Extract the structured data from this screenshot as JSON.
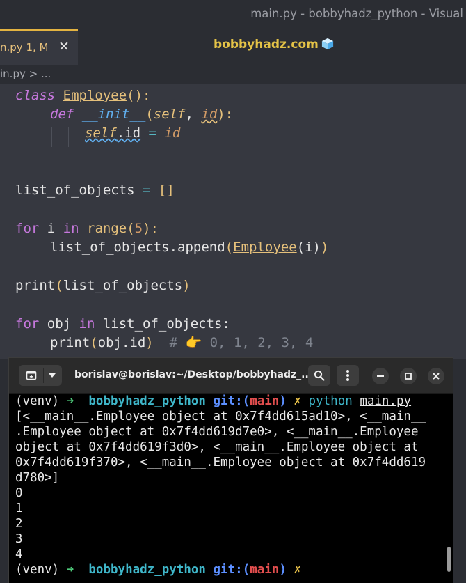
{
  "window": {
    "title": "main.py - bobbyhadz_python - Visual"
  },
  "tab": {
    "label": "n.py 1, M",
    "close": "✕"
  },
  "header": {
    "site": "bobbyhadz.com"
  },
  "breadcrumb": {
    "text": "in.py > ..."
  },
  "code": {
    "l1": {
      "kw": "class",
      "name": "Employee",
      "rest": "():"
    },
    "l2": {
      "kw": "def",
      "fn": "__init__",
      "open": "(",
      "self": "self",
      "comma": ", ",
      "param": "id",
      "close": "):"
    },
    "l3": {
      "self": "self",
      "attr": ".id",
      "eq": " = ",
      "val": "id"
    },
    "l4": {
      "name": "list_of_objects",
      "eq": " = ",
      "val": "[]"
    },
    "l5": {
      "kw": "for",
      "var": " i ",
      "kw2": "in",
      "fn": "range",
      "open": "(",
      "num": "5",
      "close": "):"
    },
    "l6": {
      "obj": "list_of_objects",
      "method": ".append",
      "open": "(",
      "cls": "Employee",
      "arg": "(i)",
      "close": ")"
    },
    "l7": {
      "fn": "print",
      "open": "(",
      "arg": "list_of_objects",
      "close": ")"
    },
    "l8": {
      "kw": "for",
      "var": " obj ",
      "kw2": "in",
      "rest": " list_of_objects:"
    },
    "l9": {
      "fn": "print",
      "open": "(",
      "arg": "obj.id",
      "close": ")",
      "comment": "  # 👉 0, 1, 2, 3, 4"
    }
  },
  "terminal": {
    "title": "borislav@borislav:~/Desktop/bobbyhadz_...",
    "prompt": {
      "venv": "(venv)",
      "arrow": "➜",
      "dir": "bobbyhadz_python",
      "git": "git:(",
      "branch": "main",
      "git_close": ")",
      "dirty": "✗"
    },
    "command": {
      "cmd": "python",
      "file": "main.py"
    },
    "output": [
      "[<__main__.Employee object at 0x7f4dd615ad10>, <__main__",
      ".Employee object at 0x7f4dd619d7e0>, <__main__.Employee",
      "object at 0x7f4dd619f3d0>, <__main__.Employee object at",
      "0x7f4dd619f370>, <__main__.Employee object at 0x7f4dd619",
      "d780>]",
      "0",
      "1",
      "2",
      "3",
      "4"
    ]
  },
  "icons": {
    "new_tab": "new-tab-icon",
    "dropdown": "chevron-down-icon",
    "search": "search-icon",
    "menu": "kebab-menu-icon",
    "minimize": "minimize-icon",
    "maximize": "maximize-icon",
    "close": "close-icon"
  },
  "colors": {
    "editor_bg": "#363840",
    "terminal_bg": "#000000",
    "accent": "#e3b341"
  }
}
